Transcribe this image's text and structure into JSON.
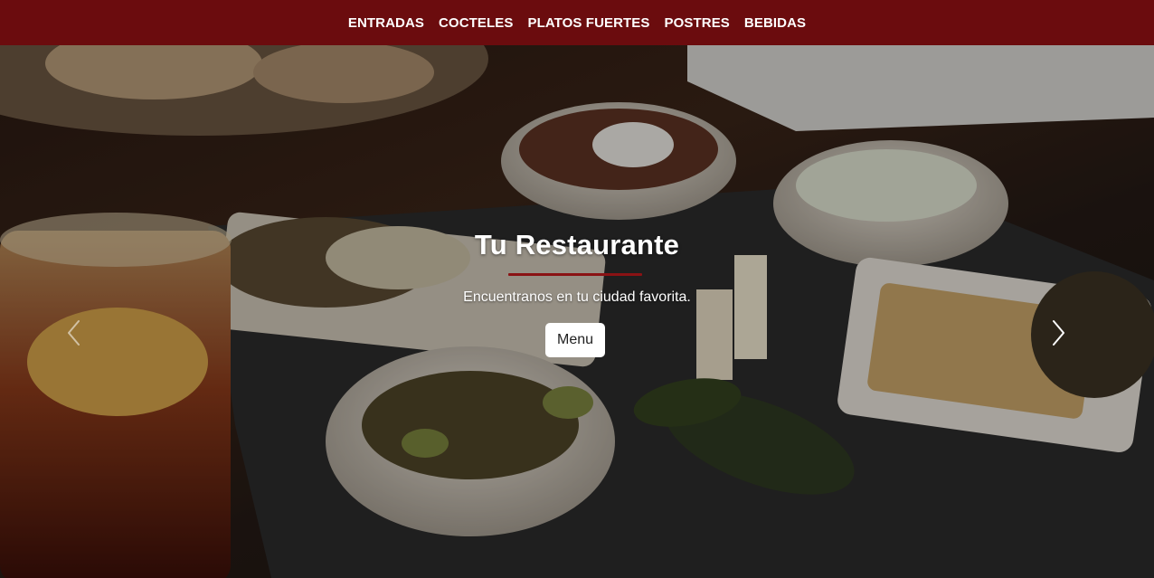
{
  "nav": {
    "items": [
      {
        "label": "ENTRADAS"
      },
      {
        "label": "COCTELES"
      },
      {
        "label": "PLATOS FUERTES"
      },
      {
        "label": "POSTRES"
      },
      {
        "label": "BEBIDAS"
      }
    ],
    "background_color": "#6b0c0e"
  },
  "hero": {
    "title": "Tu Restaurante",
    "tagline": "Encuentranos en tu ciudad favorita.",
    "button_label": "Menu",
    "accent_color": "#8a1214",
    "prev_icon": "chevron-left-icon",
    "next_icon": "chevron-right-icon"
  }
}
